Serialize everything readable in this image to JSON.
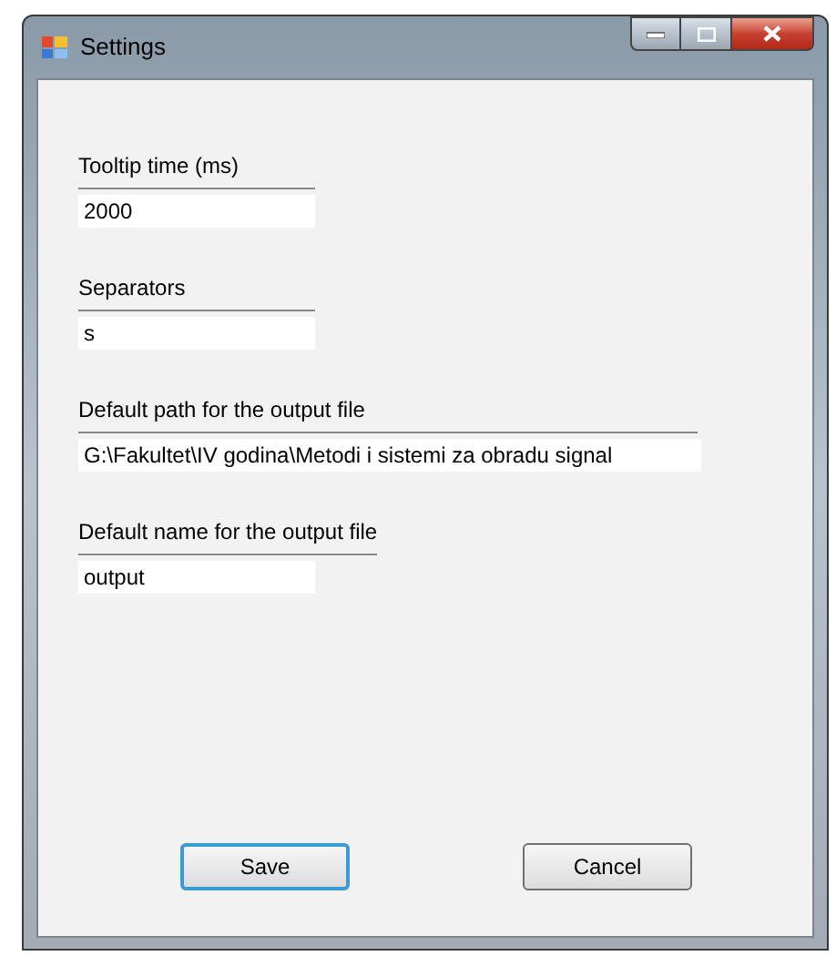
{
  "window": {
    "title": "Settings"
  },
  "fields": [
    {
      "label": "Tooltip time (ms)",
      "value": "2000",
      "kind": "short"
    },
    {
      "label": "Separators",
      "value": "s",
      "kind": "short"
    },
    {
      "label": "Default path for the output file",
      "value": "G:\\Fakultet\\IV godina\\Metodi i sistemi za obradu signal",
      "kind": "long"
    },
    {
      "label": "Default name for the output file",
      "value": "output",
      "kind": "short"
    }
  ],
  "buttons": [
    {
      "label": "Save",
      "default": true
    },
    {
      "label": "Cancel",
      "default": false
    }
  ]
}
